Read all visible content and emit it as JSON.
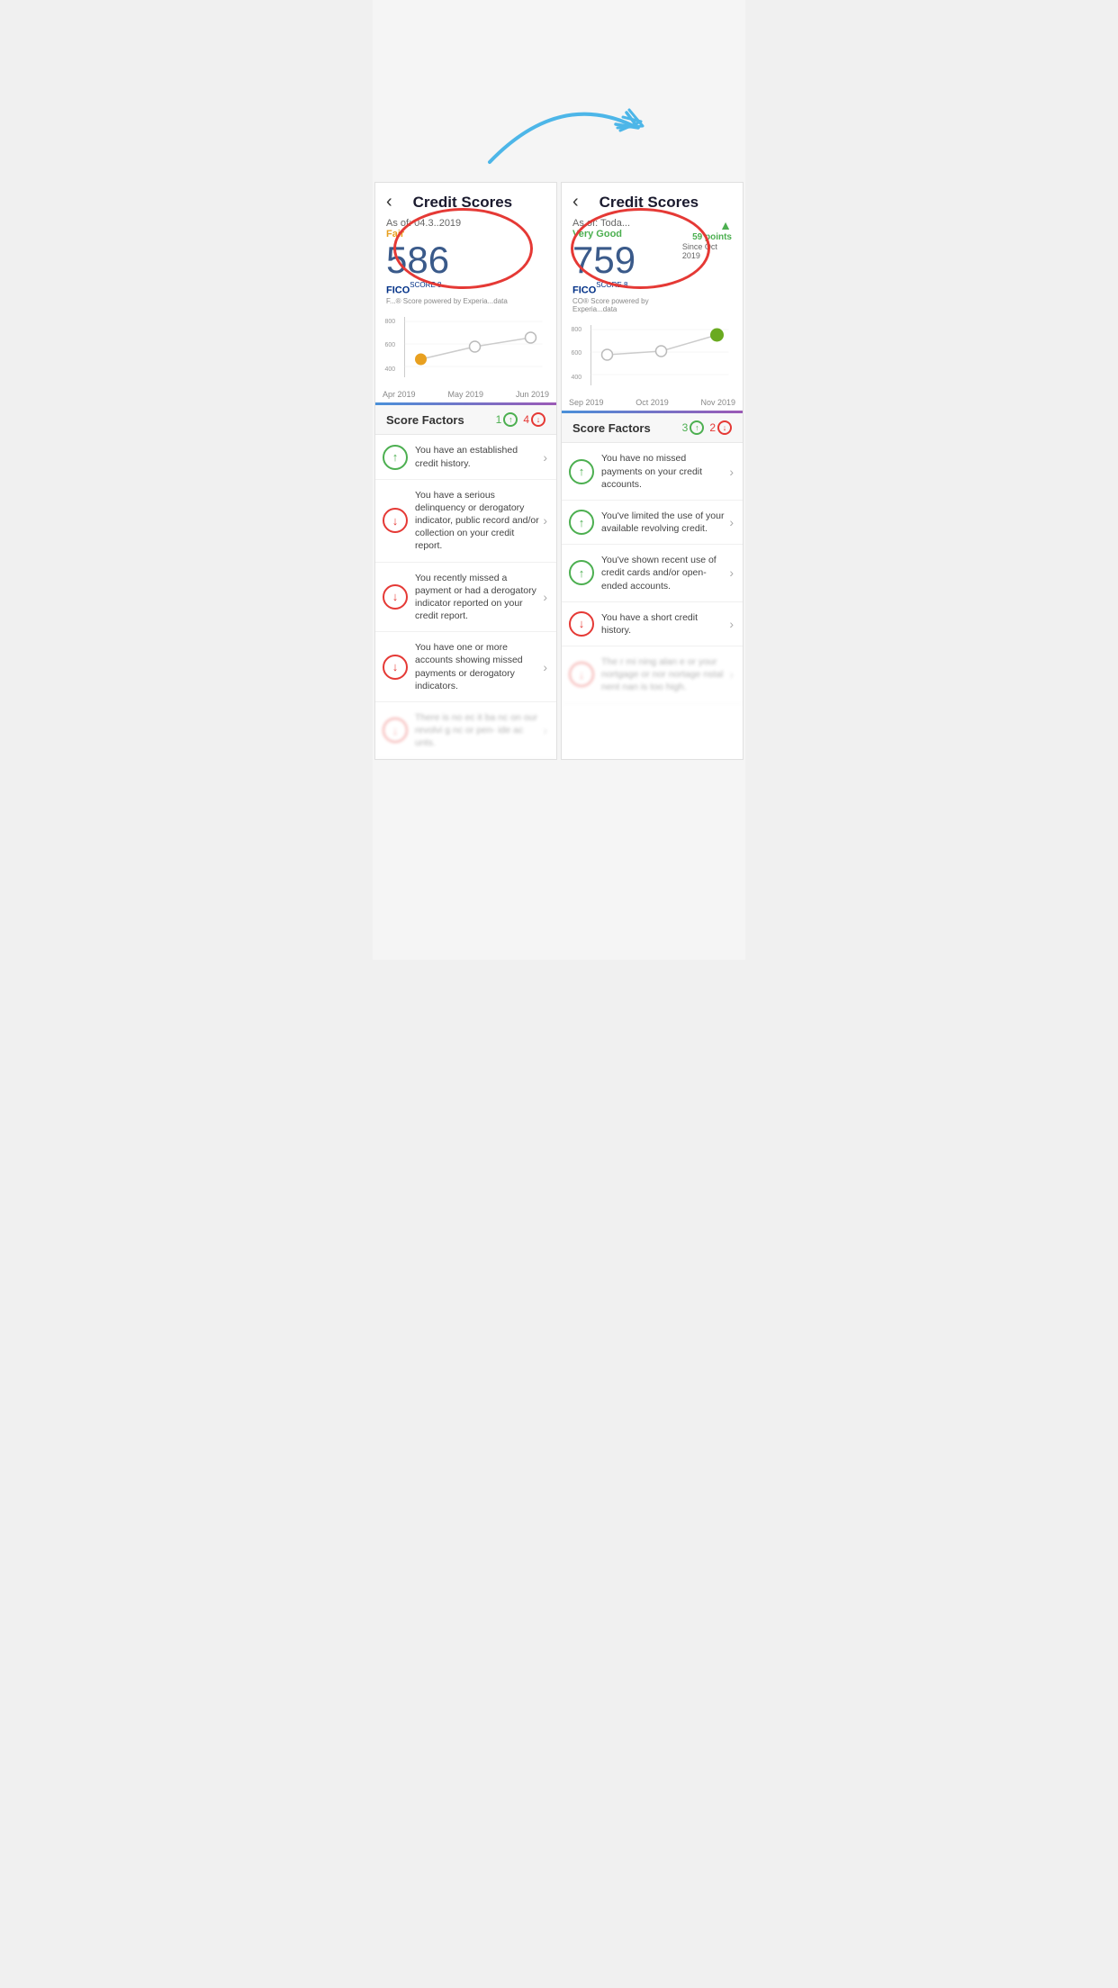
{
  "panels": [
    {
      "id": "left",
      "title": "Credit Scores",
      "as_of": "As of: 04.3..2019",
      "score_label": "Fair",
      "score_label_class": "fair",
      "score": "586",
      "fico_brand": "FICO",
      "fico_score_label": "SCORE 8",
      "powered_by": "F...® Score powered by Experia...data",
      "points_badge": null,
      "chart": {
        "y_labels": [
          "800",
          "600",
          "400"
        ],
        "x_labels": [
          "Apr 2019",
          "May 2019",
          "Jun 2019"
        ],
        "dots": [
          {
            "cx": "18%",
            "cy": "65%",
            "filled": true,
            "color": "#e8a020"
          },
          {
            "cx": "52%",
            "cy": "48%",
            "filled": false,
            "color": "#aaa"
          },
          {
            "cx": "86%",
            "cy": "38%",
            "filled": false,
            "color": "#aaa"
          }
        ]
      },
      "score_factors": {
        "title": "Score Factors",
        "up_count": "1",
        "down_count": "4",
        "items": [
          {
            "direction": "up",
            "text": "You have an established credit history."
          },
          {
            "direction": "down",
            "text": "You have a serious delinquency or derogatory indicator, public record and/or collection on your credit report."
          },
          {
            "direction": "down",
            "text": "You recently missed a payment or had a derogatory indicator reported on your credit report."
          },
          {
            "direction": "down",
            "text": "You have one or more accounts showing missed payments or derogatory indicators."
          },
          {
            "direction": "down",
            "text": "There is no ec it ba nc on our revolvi g nc or pen- ide ac unts.",
            "blurred": true
          }
        ]
      }
    },
    {
      "id": "right",
      "title": "Credit Scores",
      "as_of": "As of: Toda...",
      "score_label": "Very Good",
      "score_label_class": "verygood",
      "score": "759",
      "fico_brand": "FICO",
      "fico_score_label": "SCORE 8",
      "powered_by": "CO® Score powered by Experia...data",
      "points_badge": {
        "arrow": "▲",
        "points": "59 points",
        "since": "Since Oct 2019"
      },
      "chart": {
        "y_labels": [
          "800",
          "600",
          "400"
        ],
        "x_labels": [
          "Sep 2019",
          "Oct 2019",
          "Nov 2019"
        ],
        "dots": [
          {
            "cx": "18%",
            "cy": "50%",
            "filled": false,
            "color": "#aaa"
          },
          {
            "cx": "52%",
            "cy": "45%",
            "filled": false,
            "color": "#aaa"
          },
          {
            "cx": "86%",
            "cy": "20%",
            "filled": true,
            "color": "#6aaa20"
          }
        ]
      },
      "score_factors": {
        "title": "Score Factors",
        "up_count": "3",
        "down_count": "2",
        "items": [
          {
            "direction": "up",
            "text": "You have no missed payments on your credit accounts."
          },
          {
            "direction": "up",
            "text": "You've limited the use of your available revolving credit."
          },
          {
            "direction": "up",
            "text": "You've shown recent use of credit cards and/or open-ended accounts."
          },
          {
            "direction": "down",
            "text": "You have a short credit history."
          },
          {
            "direction": "down",
            "text": "The r mi ning alan e or your nortgage or nor nortage nstal nent nan is too high.",
            "blurred": true
          }
        ]
      }
    }
  ],
  "annotation": {
    "arrow_color": "#4db6e8",
    "circle_color": "#e53935"
  },
  "back_button_label": "‹"
}
